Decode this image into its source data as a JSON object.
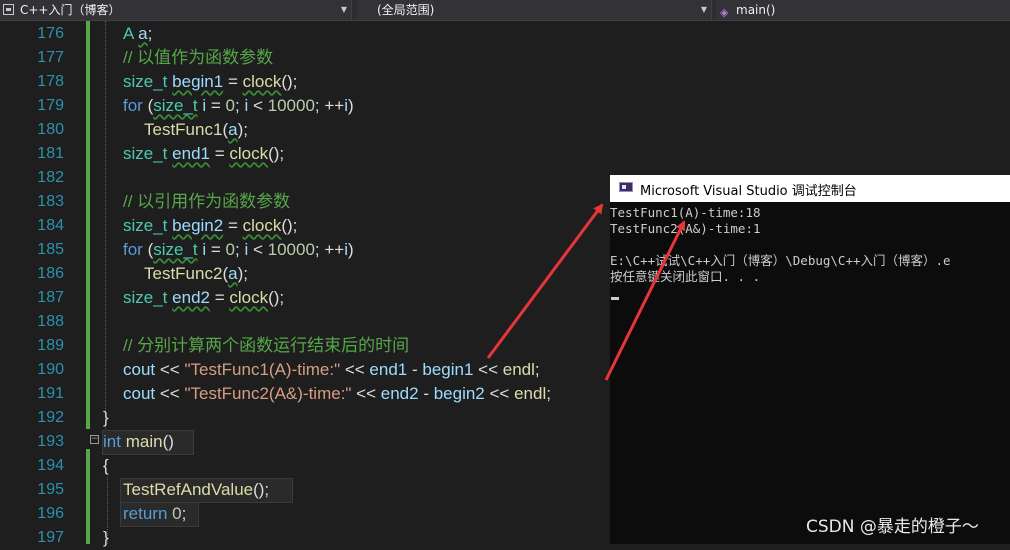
{
  "navbar": {
    "project": "C++入门（博客）",
    "scope": "(全局范围)",
    "member": "main()"
  },
  "editor": {
    "line_numbers": [
      "176",
      "177",
      "178",
      "179",
      "180",
      "181",
      "182",
      "183",
      "184",
      "185",
      "186",
      "187",
      "188",
      "189",
      "190",
      "191",
      "192",
      "193",
      "194",
      "195",
      "196",
      "197"
    ],
    "lines": [
      {
        "id": "176",
        "tokens": [
          [
            "ty",
            "A"
          ],
          [
            "txt",
            " "
          ],
          [
            "vr",
            "a"
          ],
          [
            "txt",
            ";"
          ]
        ]
      },
      {
        "id": "177",
        "tokens": [
          [
            "cm",
            "// 以值作为函数参数"
          ]
        ]
      },
      {
        "id": "178",
        "tokens": [
          [
            "ty",
            "size_t"
          ],
          [
            "txt",
            " "
          ],
          [
            "vr",
            "begin1"
          ],
          [
            "txt",
            " = "
          ],
          [
            "fn",
            "clock"
          ],
          [
            "txt",
            "();"
          ]
        ]
      },
      {
        "id": "179",
        "tokens": [
          [
            "kw",
            "for"
          ],
          [
            "txt",
            " ("
          ],
          [
            "ty",
            "size_t"
          ],
          [
            "txt",
            " "
          ],
          [
            "vr",
            "i"
          ],
          [
            "txt",
            " = "
          ],
          [
            "nm",
            "0"
          ],
          [
            "txt",
            "; "
          ],
          [
            "vr",
            "i"
          ],
          [
            "txt",
            " < "
          ],
          [
            "nm",
            "10000"
          ],
          [
            "txt",
            "; ++"
          ],
          [
            "vr",
            "i"
          ],
          [
            "txt",
            ")"
          ]
        ]
      },
      {
        "id": "180",
        "tokens": [
          [
            "fn",
            "TestFunc1"
          ],
          [
            "txt",
            "("
          ],
          [
            "vr",
            "a"
          ],
          [
            "txt",
            ");"
          ]
        ]
      },
      {
        "id": "181",
        "tokens": [
          [
            "ty",
            "size_t"
          ],
          [
            "txt",
            " "
          ],
          [
            "vr",
            "end1"
          ],
          [
            "txt",
            " = "
          ],
          [
            "fn",
            "clock"
          ],
          [
            "txt",
            "();"
          ]
        ]
      },
      {
        "id": "182",
        "tokens": []
      },
      {
        "id": "183",
        "tokens": [
          [
            "cm",
            "// 以引用作为函数参数"
          ]
        ]
      },
      {
        "id": "184",
        "tokens": [
          [
            "ty",
            "size_t"
          ],
          [
            "txt",
            " "
          ],
          [
            "vr",
            "begin2"
          ],
          [
            "txt",
            " = "
          ],
          [
            "fn",
            "clock"
          ],
          [
            "txt",
            "();"
          ]
        ]
      },
      {
        "id": "185",
        "tokens": [
          [
            "kw",
            "for"
          ],
          [
            "txt",
            " ("
          ],
          [
            "ty",
            "size_t"
          ],
          [
            "txt",
            " "
          ],
          [
            "vr",
            "i"
          ],
          [
            "txt",
            " = "
          ],
          [
            "nm",
            "0"
          ],
          [
            "txt",
            "; "
          ],
          [
            "vr",
            "i"
          ],
          [
            "txt",
            " < "
          ],
          [
            "nm",
            "10000"
          ],
          [
            "txt",
            "; ++"
          ],
          [
            "vr",
            "i"
          ],
          [
            "txt",
            ")"
          ]
        ]
      },
      {
        "id": "186",
        "tokens": [
          [
            "fn",
            "TestFunc2"
          ],
          [
            "txt",
            "("
          ],
          [
            "vr",
            "a"
          ],
          [
            "txt",
            ");"
          ]
        ]
      },
      {
        "id": "187",
        "tokens": [
          [
            "ty",
            "size_t"
          ],
          [
            "txt",
            " "
          ],
          [
            "vr",
            "end2"
          ],
          [
            "txt",
            " = "
          ],
          [
            "fn",
            "clock"
          ],
          [
            "txt",
            "();"
          ]
        ]
      },
      {
        "id": "188",
        "tokens": []
      },
      {
        "id": "189",
        "tokens": [
          [
            "cm",
            "// 分别计算两个函数运行结束后的时间"
          ]
        ]
      },
      {
        "id": "190",
        "tokens": [
          [
            "vr",
            "cout"
          ],
          [
            "txt",
            " << "
          ],
          [
            "st",
            "\"TestFunc1(A)-time:\""
          ],
          [
            "txt",
            " << "
          ],
          [
            "vr",
            "end1"
          ],
          [
            "txt",
            " - "
          ],
          [
            "vr",
            "begin1"
          ],
          [
            "txt",
            " << "
          ],
          [
            "fn",
            "endl"
          ],
          [
            "txt",
            ";"
          ]
        ]
      },
      {
        "id": "191",
        "tokens": [
          [
            "vr",
            "cout"
          ],
          [
            "txt",
            " << "
          ],
          [
            "st",
            "\"TestFunc2(A&)-time:\""
          ],
          [
            "txt",
            " << "
          ],
          [
            "vr",
            "end2"
          ],
          [
            "txt",
            " - "
          ],
          [
            "vr",
            "begin2"
          ],
          [
            "txt",
            " << "
          ],
          [
            "fn",
            "endl"
          ],
          [
            "txt",
            ";"
          ]
        ]
      },
      {
        "id": "192",
        "tokens": [
          [
            "txt",
            "}"
          ]
        ]
      },
      {
        "id": "193",
        "tokens": [
          [
            "kw",
            "int"
          ],
          [
            "txt",
            " "
          ],
          [
            "fn",
            "main"
          ],
          [
            "txt",
            "()"
          ]
        ]
      },
      {
        "id": "194",
        "tokens": [
          [
            "txt",
            "{"
          ]
        ]
      },
      {
        "id": "195",
        "tokens": [
          [
            "fn",
            "TestRefAndValue"
          ],
          [
            "txt",
            "();"
          ]
        ]
      },
      {
        "id": "196",
        "tokens": [
          [
            "kw",
            "return"
          ],
          [
            "txt",
            " "
          ],
          [
            "nm",
            "0"
          ],
          [
            "txt",
            ";"
          ]
        ]
      },
      {
        "id": "197",
        "tokens": [
          [
            "txt",
            "}"
          ]
        ]
      }
    ]
  },
  "console": {
    "title": "Microsoft Visual Studio 调试控制台",
    "output": [
      "TestFunc1(A)-time:18",
      "TestFunc2(A&)-time:1",
      "",
      "E:\\C++试试\\C++入门（博客）\\Debug\\C++入门（博客）.e",
      "按任意键关闭此窗口. . ."
    ]
  },
  "watermark": "CSDN @暴走的橙子～",
  "colors": {
    "background": "#1e1e1e",
    "keyword": "#569cd6",
    "type": "#4ec9b0",
    "function": "#dcdcaa",
    "variable": "#9cdcfe",
    "comment": "#57a64a",
    "string": "#d69d85",
    "number": "#b5cea8",
    "line_number": "#2b91af",
    "annotation_arrow": "#e8353a"
  }
}
